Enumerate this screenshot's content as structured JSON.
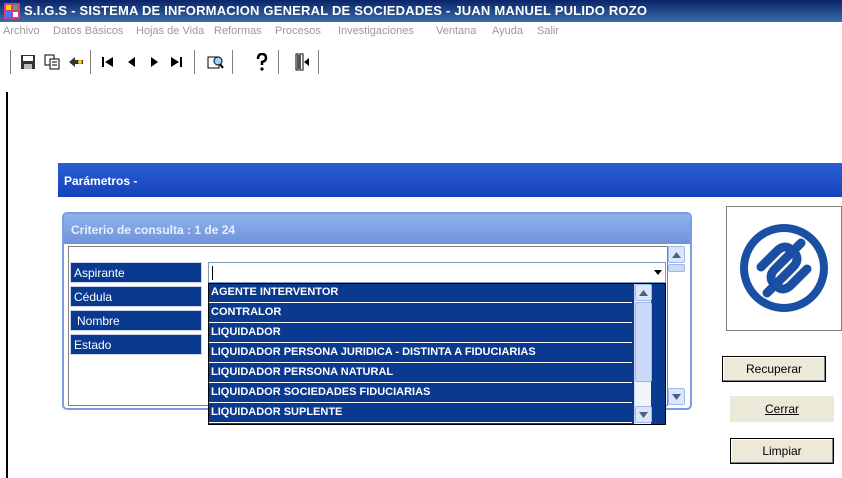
{
  "window": {
    "title": "S.I.G.S   - SISTEMA DE INFORMACION GENERAL DE SOCIEDADES - JUAN MANUEL PULIDO ROZO",
    "accent": "#0a246a"
  },
  "menu": {
    "items": [
      "Archivo",
      "Datos Básicos",
      "Hojas de Vida",
      "Reformas",
      "Procesos",
      "Investigaciones",
      "Ventana",
      "Ayuda",
      "Salir"
    ]
  },
  "toolbar": {
    "icons": [
      "save-icon",
      "copy-icon",
      "undo-icon",
      "first-record-icon",
      "previous-record-icon",
      "next-record-icon",
      "last-record-icon",
      "query-icon",
      "help-icon",
      "exit-icon"
    ]
  },
  "params": {
    "title": "Parámetros -"
  },
  "criteria": {
    "header": "Criterio de consulta : 1  de  24",
    "fields": [
      "Aspirante",
      "Cédula",
      "Nombre",
      "Estado"
    ],
    "combo_value": ""
  },
  "dropdown": {
    "options": [
      "AGENTE INTERVENTOR",
      "CONTRALOR",
      "LIQUIDADOR",
      "LIQUIDADOR PERSONA JURIDICA - DISTINTA A FIDUCIARIAS",
      "LIQUIDADOR PERSONA NATURAL",
      "LIQUIDADOR SOCIEDADES FIDUCIARIAS",
      "LIQUIDADOR SUPLENTE"
    ],
    "highlight_color": "#0a3a8f"
  },
  "buttons": {
    "recuperar": "Recuperar",
    "cerrar": "Cerrar",
    "limpiar": "Limpiar"
  }
}
